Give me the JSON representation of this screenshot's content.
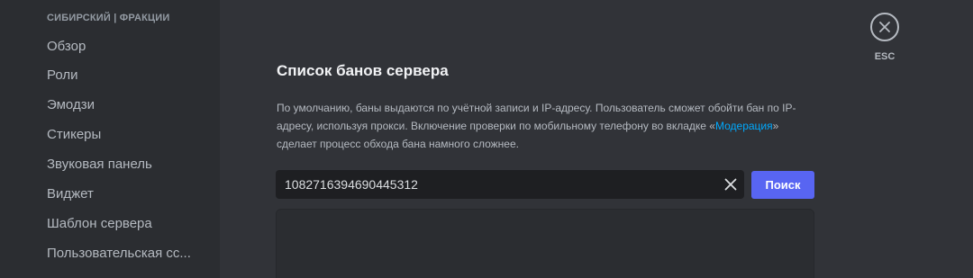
{
  "sidebar": {
    "header": "СИБИРСКИЙ | ФРАКЦИИ",
    "items": [
      {
        "label": "Обзор"
      },
      {
        "label": "Роли"
      },
      {
        "label": "Эмодзи"
      },
      {
        "label": "Стикеры"
      },
      {
        "label": "Звуковая панель"
      },
      {
        "label": "Виджет"
      },
      {
        "label": "Шаблон сервера"
      },
      {
        "label": "Пользовательская сс..."
      }
    ]
  },
  "main": {
    "title": "Список банов сервера",
    "description": {
      "part1": "По умолчанию, баны выдаются по учётной записи и IP-адресу. Пользователь сможет обойти бан по IP-адресу, используя прокси. Включение проверки по мобильному телефону во вкладке «",
      "link": "Модерация",
      "part2": "» сделает процесс обхода бана намного сложнее."
    },
    "search": {
      "value": "1082716394690445312",
      "button_label": "Поиск"
    }
  },
  "close": {
    "esc_label": "ESC"
  },
  "icons": {
    "clear": "close-icon",
    "close": "close-icon"
  },
  "colors": {
    "accent": "#5865f2",
    "link": "#00a8fc",
    "background": "#313338",
    "sidebar": "#2b2d31"
  }
}
